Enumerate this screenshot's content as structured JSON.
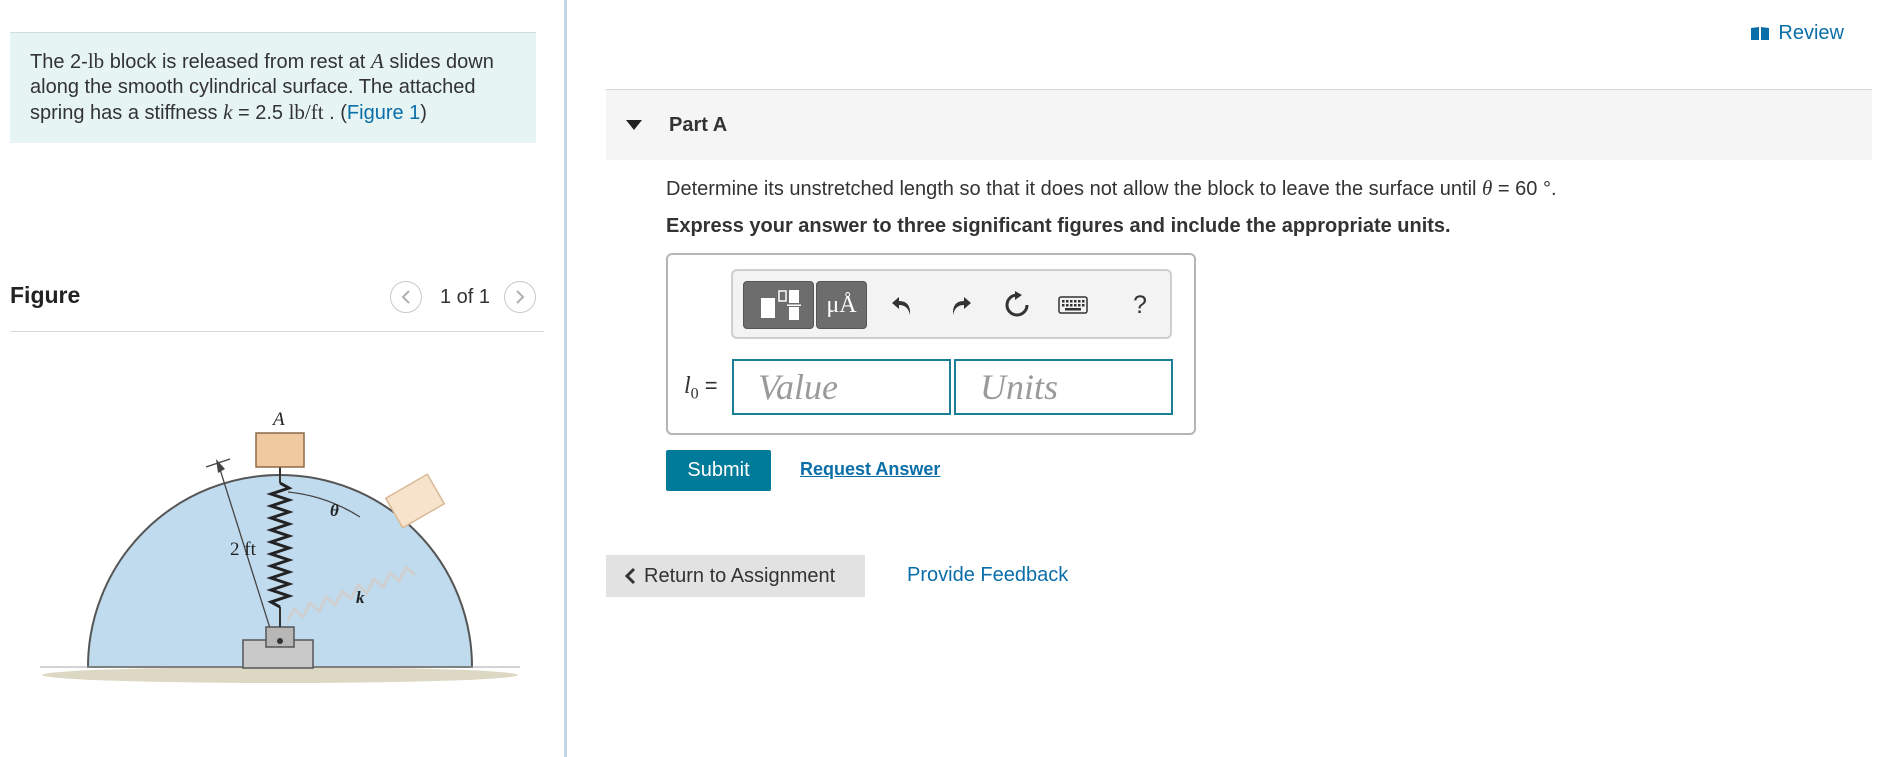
{
  "problem": {
    "text_before_A": "The 2-",
    "unit_lb": "lb",
    "text_mid1": " block is released from rest at ",
    "point_A": "A",
    "text_mid2": " slides down along the smooth cylindrical surface. The attached spring has a stiffness ",
    "k_symbol": "k",
    "k_equals": " = 2.5 ",
    "k_unit": "lb/ft",
    "text_after": " . (",
    "figure_link": "Figure 1",
    "close_paren": ")"
  },
  "figure_panel": {
    "title": "Figure",
    "pager_text": "1 of 1",
    "prev_icon": "chevron-left-icon",
    "next_icon": "chevron-right-icon",
    "labels": {
      "point": "A",
      "angle": "θ",
      "radius": "2 ft",
      "spring": "k"
    }
  },
  "header": {
    "review_label": "Review",
    "review_icon": "book-icon"
  },
  "part": {
    "title": "Part A",
    "toggle_icon": "caret-down-icon"
  },
  "question": {
    "text_before": "Determine its unstretched length so that it does not allow the block to leave the surface until ",
    "theta": "θ",
    "text_after": " = 60 °.",
    "instruction": "Express your answer to three significant figures and include the appropriate units."
  },
  "answer": {
    "toolbar": {
      "templates_icon": "templates-icon",
      "units_label": "μÅ",
      "undo_icon": "undo-icon",
      "redo_icon": "redo-icon",
      "reset_icon": "reset-icon",
      "keyboard_icon": "keyboard-icon",
      "help_label": "?"
    },
    "lhs_var": "l",
    "lhs_sub": "0",
    "lhs_eq": " =",
    "value_placeholder": "Value",
    "units_placeholder": "Units"
  },
  "actions": {
    "submit": "Submit",
    "request_answer": "Request Answer",
    "return_label": "Return to Assignment",
    "feedback": "Provide Feedback"
  },
  "colors": {
    "accent": "#007b9a",
    "link": "#0a6ea8",
    "problem_bg": "#e6f4f4",
    "cylinder": "#c0dbee",
    "block": "#f0c9a0"
  }
}
